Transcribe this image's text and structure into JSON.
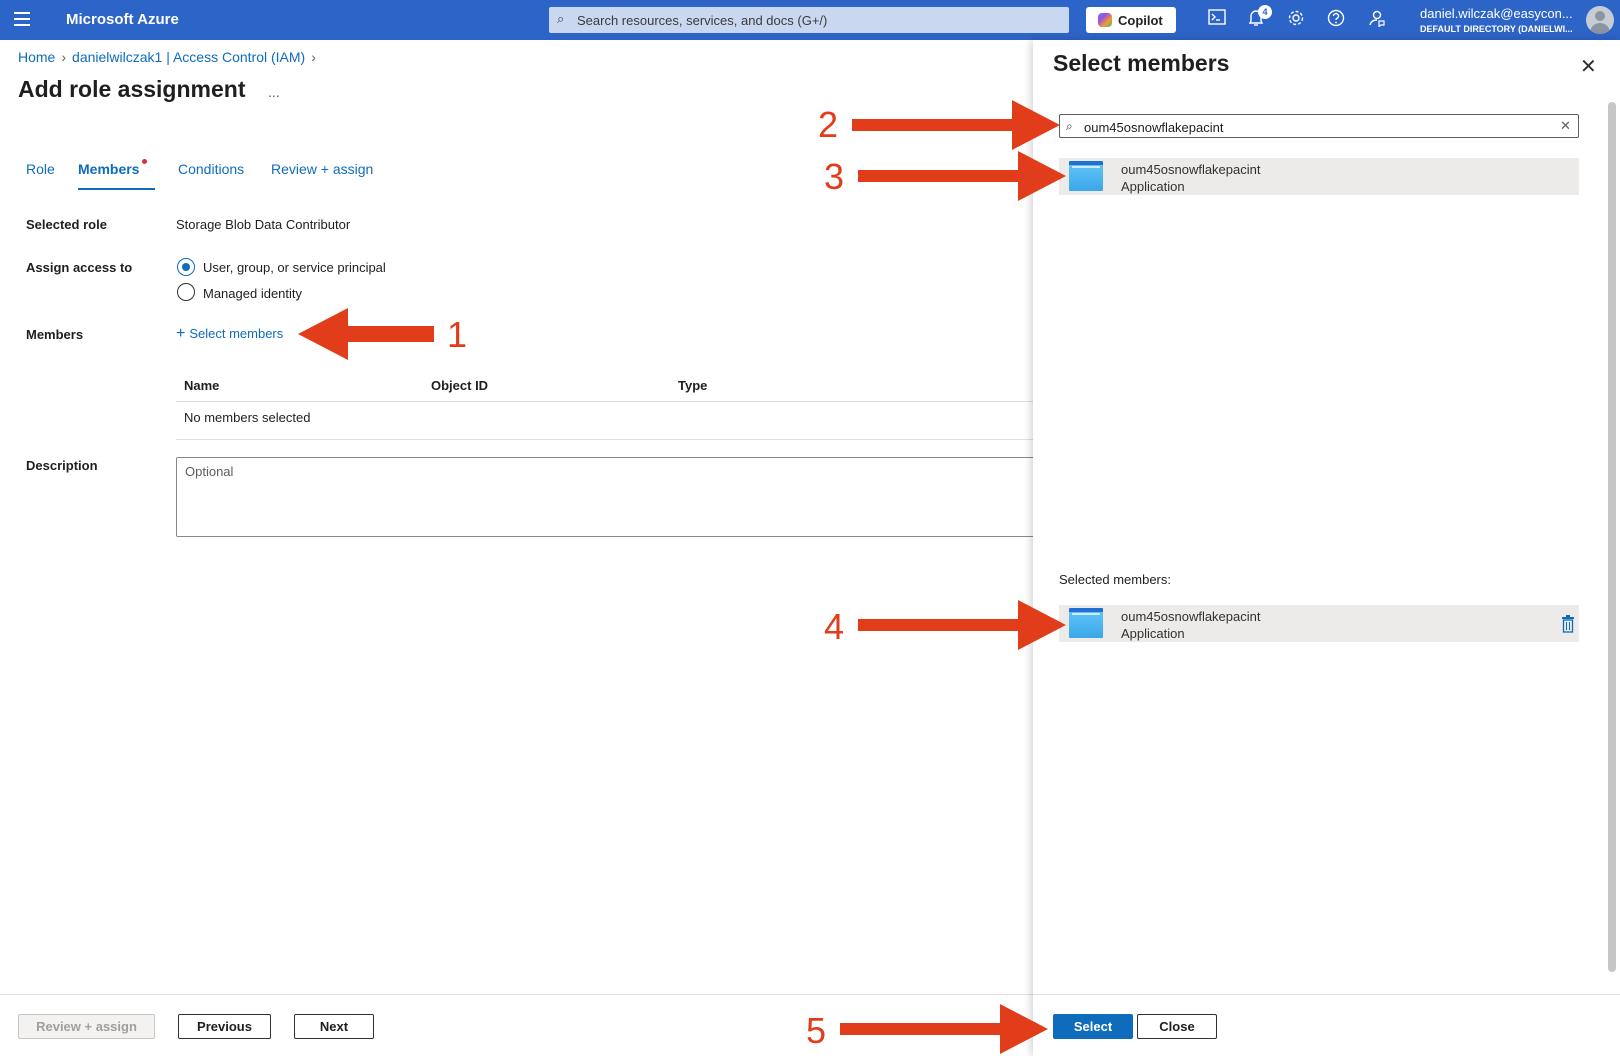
{
  "topbar": {
    "brand": "Microsoft Azure",
    "search_placeholder": "Search resources, services, and docs (G+/)",
    "copilot_label": "Copilot",
    "notification_count": "4",
    "account_email": "daniel.wilczak@easycon...",
    "account_directory": "DEFAULT DIRECTORY (DANIELWI..."
  },
  "breadcrumb": {
    "home": "Home",
    "resource": "danielwilczak1 | Access Control (IAM)"
  },
  "page": {
    "title": "Add role assignment",
    "more": "..."
  },
  "tabs": [
    {
      "label": "Role"
    },
    {
      "label": "Members"
    },
    {
      "label": "Conditions"
    },
    {
      "label": "Review + assign"
    }
  ],
  "form": {
    "selected_role_label": "Selected role",
    "selected_role_value": "Storage Blob Data Contributor",
    "assign_access_label": "Assign access to",
    "option_user": "User, group, or service principal",
    "option_managed": "Managed identity",
    "members_label": "Members",
    "select_members_link": "Select members",
    "table_headers": [
      "Name",
      "Object ID",
      "Type"
    ],
    "empty_row": "No members selected",
    "description_label": "Description",
    "description_placeholder": "Optional"
  },
  "footer": {
    "review_assign": "Review + assign",
    "previous": "Previous",
    "next": "Next"
  },
  "panel": {
    "title": "Select members",
    "search_value": "oum45osnowflakepacint",
    "result": {
      "name": "oum45osnowflakepacint",
      "type": "Application"
    },
    "selected_label": "Selected members:",
    "selected": {
      "name": "oum45osnowflakepacint",
      "type": "Application"
    },
    "select_button": "Select",
    "close_button": "Close"
  },
  "annotations": [
    "1",
    "2",
    "3",
    "4",
    "5"
  ],
  "colors": {
    "azure_blue": "#2d64c8",
    "link_blue": "#0f6cbd",
    "annotation_red": "#e23d1b"
  }
}
